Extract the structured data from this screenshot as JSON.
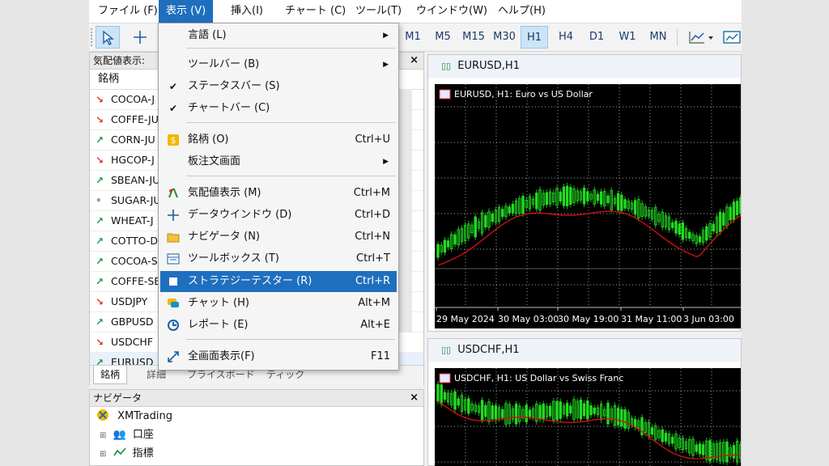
{
  "menubar": {
    "items": [
      {
        "label": "ファイル (F)"
      },
      {
        "label": "表示 (V)"
      },
      {
        "label": "挿入(I)"
      },
      {
        "label": "チャート (C)"
      },
      {
        "label": "ツール(T)"
      },
      {
        "label": "ウインドウ(W)"
      },
      {
        "label": "ヘルプ(H)"
      }
    ]
  },
  "toolbar": {
    "timeframes": [
      "M1",
      "M5",
      "M15",
      "M30",
      "H1",
      "H4",
      "D1",
      "W1",
      "MN"
    ],
    "selected_timeframe": "H1"
  },
  "market_watch": {
    "title": "気配値表示:",
    "column_header": "銘柄",
    "rows": [
      {
        "symbol": "COCOA-J",
        "dir": "down"
      },
      {
        "symbol": "COFFE-JU",
        "dir": "down"
      },
      {
        "symbol": "CORN-JU",
        "dir": "up"
      },
      {
        "symbol": "HGCOP-J",
        "dir": "down"
      },
      {
        "symbol": "SBEAN-JU",
        "dir": "up"
      },
      {
        "symbol": "SUGAR-JU",
        "dir": "neutral"
      },
      {
        "symbol": "WHEAT-J",
        "dir": "up"
      },
      {
        "symbol": "COTTO-D",
        "dir": "up"
      },
      {
        "symbol": "COCOA-S",
        "dir": "up"
      },
      {
        "symbol": "COFFE-SE",
        "dir": "up"
      },
      {
        "symbol": "USDJPY",
        "dir": "down"
      },
      {
        "symbol": "GBPUSD",
        "dir": "up"
      },
      {
        "symbol": "USDCHF",
        "dir": "down"
      },
      {
        "symbol": "EURUSD",
        "dir": "up"
      }
    ],
    "tabs": [
      "銘柄",
      "詳細",
      "プライスボード",
      "ティック"
    ]
  },
  "navigator": {
    "title": "ナビゲータ",
    "root": "XMTrading",
    "children": [
      "口座",
      "指標"
    ]
  },
  "view_menu": {
    "items": [
      {
        "label": "言語 (L)",
        "shortcut": "",
        "submenu": true,
        "check": false,
        "icon": ""
      },
      {
        "label": "ツールバー (B)",
        "shortcut": "",
        "submenu": true,
        "check": false,
        "icon": ""
      },
      {
        "label": "ステータスバー (S)",
        "shortcut": "",
        "submenu": false,
        "check": true,
        "icon": ""
      },
      {
        "label": "チャートバー (C)",
        "shortcut": "",
        "submenu": false,
        "check": true,
        "icon": ""
      },
      {
        "label": "銘柄 (O)",
        "shortcut": "Ctrl+U",
        "submenu": false,
        "check": false,
        "icon": "dollar-icon"
      },
      {
        "label": "板注文画面",
        "shortcut": "",
        "submenu": true,
        "check": false,
        "icon": ""
      },
      {
        "label": "気配値表示 (M)",
        "shortcut": "Ctrl+M",
        "submenu": false,
        "check": false,
        "icon": "market-watch-icon"
      },
      {
        "label": "データウインドウ (D)",
        "shortcut": "Ctrl+D",
        "submenu": false,
        "check": false,
        "icon": "crosshair-icon"
      },
      {
        "label": "ナビゲータ (N)",
        "shortcut": "Ctrl+N",
        "submenu": false,
        "check": false,
        "icon": "folder-icon"
      },
      {
        "label": "ツールボックス (T)",
        "shortcut": "Ctrl+T",
        "submenu": false,
        "check": false,
        "icon": "toolbox-icon"
      },
      {
        "label": "ストラテジーテスター (R)",
        "shortcut": "Ctrl+R",
        "submenu": false,
        "check": false,
        "icon": "tester-icon"
      },
      {
        "label": "チャット (H)",
        "shortcut": "Alt+M",
        "submenu": false,
        "check": false,
        "icon": "chat-icon"
      },
      {
        "label": "レポート (E)",
        "shortcut": "Alt+E",
        "submenu": false,
        "check": false,
        "icon": "report-icon"
      },
      {
        "label": "全画面表示(F)",
        "shortcut": "F11",
        "submenu": false,
        "check": false,
        "icon": "fullscreen-icon"
      }
    ],
    "highlighted": "ストラテジーテスター (R)"
  },
  "charts": [
    {
      "window_title": "EURUSD,H1",
      "label": "EURUSD, H1:  Euro vs US Dollar",
      "time_labels": [
        "29 May 2024",
        "30 May 03:00",
        "30 May 19:00",
        "31 May 11:00",
        "3 Jun 03:00"
      ]
    },
    {
      "window_title": "USDCHF,H1",
      "label": "USDCHF, H1:  US Dollar vs Swiss Franc",
      "time_labels": []
    }
  ],
  "colors": {
    "accent": "#1f6fbf",
    "candle": "#22dd22",
    "ma_line": "#cc1111",
    "chart_bg": "#000000",
    "up_arrow": "#15a04a",
    "down_arrow": "#d73a2e"
  }
}
